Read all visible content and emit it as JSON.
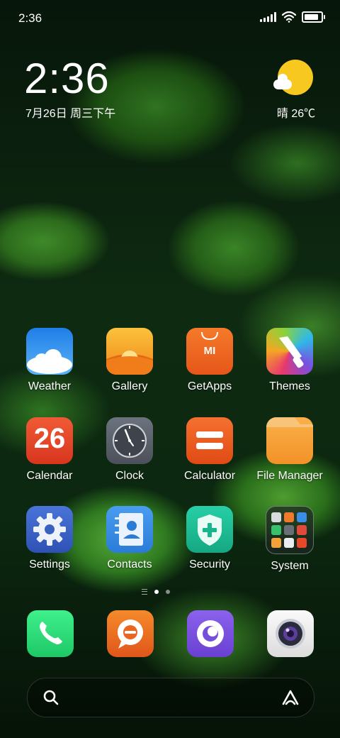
{
  "status_bar": {
    "time": "2:36",
    "battery_level": 0.85
  },
  "clock_widget": {
    "time": "2:36",
    "date": "7月26日 周三下午"
  },
  "weather_widget": {
    "text": "晴 26℃",
    "icon": "sunny-partly-cloudy-icon"
  },
  "apps": [
    {
      "label": "Weather",
      "icon": "weather-icon"
    },
    {
      "label": "Gallery",
      "icon": "gallery-icon"
    },
    {
      "label": "GetApps",
      "icon": "getapps-icon",
      "badge": "MI"
    },
    {
      "label": "Themes",
      "icon": "themes-icon"
    },
    {
      "label": "Calendar",
      "icon": "calendar-icon",
      "day": "26"
    },
    {
      "label": "Clock",
      "icon": "clock-icon"
    },
    {
      "label": "Calculator",
      "icon": "calculator-icon"
    },
    {
      "label": "File Manager",
      "icon": "folder-icon"
    },
    {
      "label": "Settings",
      "icon": "gear-icon"
    },
    {
      "label": "Contacts",
      "icon": "contacts-icon"
    },
    {
      "label": "Security",
      "icon": "shield-icon"
    },
    {
      "label": "System",
      "icon": "folder-grid-icon"
    }
  ],
  "dock": [
    {
      "icon": "phone-icon"
    },
    {
      "icon": "messaging-icon"
    },
    {
      "icon": "browser-icon"
    },
    {
      "icon": "camera-icon"
    }
  ],
  "page_indicator": {
    "pages": 2,
    "current": 1
  },
  "search": {
    "icon": "search-icon",
    "assistant_icon": "assistant-icon"
  },
  "colors": {
    "weather": "#2f8be8",
    "gallery": "#f39b1c",
    "getapps": "#f06a1e",
    "themes": "#e24a7a",
    "calendar": "#e8472a",
    "clock": "#5e6470",
    "calculator": "#ef5b1d",
    "file_manager": "#f8a43a",
    "settings": "#3b63c8",
    "contacts": "#3a8ee8",
    "security": "#1fbf9a",
    "phone": "#2ee07a",
    "messaging": "#ef6a1a",
    "browser": "#7b52e0",
    "camera": "#eeeeee"
  }
}
